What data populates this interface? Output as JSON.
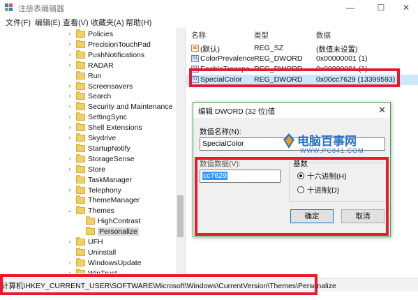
{
  "window": {
    "title": "注册表编辑器",
    "min": "—",
    "max": "☐",
    "close": "✕"
  },
  "menu": [
    "文件(F)",
    "编辑(E)",
    "查看(V)",
    "收藏夹(A)",
    "帮助(H)"
  ],
  "left_cut": "A",
  "tree": {
    "items": [
      {
        "label": "Policies",
        "expand": "›"
      },
      {
        "label": "PrecisionTouchPad",
        "expand": "›"
      },
      {
        "label": "PushNotifications",
        "expand": "›"
      },
      {
        "label": "RADAR",
        "expand": "›"
      },
      {
        "label": "Run",
        "expand": ""
      },
      {
        "label": "Screensavers",
        "expand": "›"
      },
      {
        "label": "Search",
        "expand": "›"
      },
      {
        "label": "Security and Maintenance",
        "expand": "›"
      },
      {
        "label": "SettingSync",
        "expand": "›"
      },
      {
        "label": "Shell Extensions",
        "expand": "›"
      },
      {
        "label": "Skydrive",
        "expand": "›"
      },
      {
        "label": "StartupNotify",
        "expand": ""
      },
      {
        "label": "StorageSense",
        "expand": "›"
      },
      {
        "label": "Store",
        "expand": "›"
      },
      {
        "label": "TaskManager",
        "expand": ""
      },
      {
        "label": "Telephony",
        "expand": "›"
      },
      {
        "label": "ThemeManager",
        "expand": ""
      },
      {
        "label": "Themes",
        "expand": "⌄"
      },
      {
        "label": "HighContrast",
        "expand": ""
      },
      {
        "label": "Personalize",
        "expand": ""
      },
      {
        "label": "UFH",
        "expand": "›"
      },
      {
        "label": "Uninstall",
        "expand": ""
      },
      {
        "label": "WindowsUpdate",
        "expand": "›"
      },
      {
        "label": "WinTrust",
        "expand": "›"
      }
    ]
  },
  "list": {
    "headers": {
      "name": "名称",
      "type": "类型",
      "data": "数据"
    },
    "rows": [
      {
        "icon": "ab",
        "name": "(默认)",
        "type": "REG_SZ",
        "data": "(数值未设置)"
      },
      {
        "icon": "01",
        "name": "ColorPrevalence",
        "type": "REG_DWORD",
        "data": "0x00000001 (1)"
      },
      {
        "icon": "01",
        "name": "EnableTranspa...",
        "type": "REG_DWORD",
        "data": "0x00000001 (1)"
      },
      {
        "icon": "01",
        "name": "SpecialColor",
        "type": "REG_DWORD",
        "data": "0x00cc7629 (13399593)"
      }
    ]
  },
  "status": "计算机\\HKEY_CURRENT_USER\\SOFTWARE\\Microsoft\\Windows\\CurrentVersion\\Themes\\Personalize",
  "dialog": {
    "title": "编辑 DWORD (32 位)值",
    "close": "✕",
    "name_label": "数值名称(N):",
    "name_value": "SpecialColor",
    "data_label": "数值数据(V):",
    "data_value": "cc7629",
    "base_label": "基数",
    "hex_label": "十六进制(H)",
    "dec_label": "十进制(D)",
    "ok": "确定",
    "cancel": "取消"
  },
  "watermark": {
    "brand": "电脑百事网",
    "url": "WWW.PC841.COM"
  },
  "colors": {
    "highlight": "#e81a2c",
    "dialog_border": "#3fa446",
    "selection": "#3399ff",
    "watermark": "#2a72c8"
  }
}
